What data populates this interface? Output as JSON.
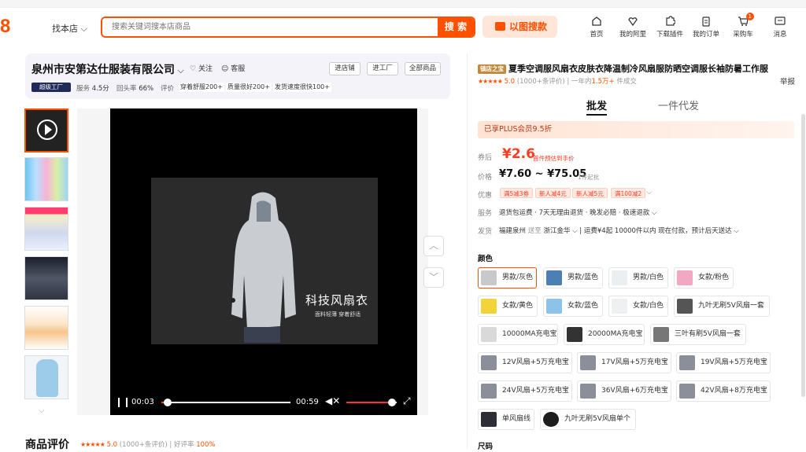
{
  "header": {
    "top_strip": "",
    "find_shop": "找本店 ⌵",
    "search_placeholder": "搜索关键词搜本店商品",
    "search_button": "搜 索",
    "image_search": "以图搜款",
    "nav": [
      {
        "label": "首页",
        "icon": "home-icon"
      },
      {
        "label": "我的阿里",
        "icon": "user-heart-icon"
      },
      {
        "label": "下载插件",
        "icon": "puzzle-icon"
      },
      {
        "label": "我的订单",
        "icon": "clipboard-icon"
      },
      {
        "label": "采购车",
        "icon": "cart-icon",
        "badge": "1"
      },
      {
        "label": "消息",
        "icon": "message-icon"
      }
    ]
  },
  "shop": {
    "name": "泉州市安第达仕服装有限公司",
    "follow": "关注",
    "service": "客服",
    "buttons": [
      "进店铺",
      "进工厂",
      "全部商品"
    ],
    "super_badge": "超级工厂",
    "service_score_label": "服务",
    "service_score": "4.5分",
    "return_rate_label": "回头率",
    "return_rate": "66%",
    "review_label": "评价",
    "tags": [
      "穿着舒服200+",
      "质量很好200+",
      "发货速度很快100+"
    ]
  },
  "video": {
    "title": "科技风扇衣",
    "subtitle": "面料轻薄 穿着舒适",
    "current_time": "00:03",
    "duration": "00:59",
    "progress": 0.05,
    "volume": 0.9
  },
  "reviews": {
    "title": "商品评价",
    "rating": "5.0",
    "count": "(1000+条评价)",
    "good_rate_label": "好评率",
    "good_rate": "100%"
  },
  "product": {
    "tag": "镇店之宝",
    "title": "夏季空调服风扇衣皮肤衣降温制冷风扇服防晒空调服长袖防暑工作服",
    "rating": "5.0",
    "rating_count": "(1000+条评价)",
    "sales_prefix": "一年内",
    "sales_value": "1.5万+",
    "sales_suffix": "件成交",
    "report": "举报",
    "tabs": [
      "批发",
      "一件代发"
    ],
    "plus_banner": "已享PLUS会员9.5折",
    "coupon_label": "券后",
    "coupon_price": "¥2.6",
    "coupon_note": "首件预估到手价",
    "price_label": "价格",
    "price_low": "¥7.60",
    "price_sep": "~",
    "price_high": "¥75.05",
    "price_note": "1件起批",
    "promo_label": "优惠",
    "promos": [
      "满5减3券",
      "新人减4元",
      "新人减5元",
      "满100减2"
    ],
    "service_label": "服务",
    "service_text": "退货包运费 · 7天无理由退货 · 晚发必赔 · 极速退款 ⌵",
    "ship_label": "发货",
    "ship_from": "福建泉州",
    "ship_to_prefix": "送至",
    "ship_to": "浙江金华 ⌵",
    "ship_fee": "运费¥4起",
    "ship_note": "10000件以内 现在付款，预计后天送达 ⌵",
    "color_title": "颜色",
    "colors": [
      "男款/灰色",
      "男款/蓝色",
      "男款/白色",
      "女款/粉色",
      "女款/黄色",
      "女款/蓝色",
      "女款/白色",
      "九叶无刷5V风扇一套",
      "10000MA充电宝",
      "20000MA充电宝",
      "三叶有刷5V风扇一套",
      "12V风扇+5万充电宝",
      "17V风扇+5万充电宝",
      "19V风扇+5万充电宝",
      "24V风扇+5万充电宝",
      "36V风扇+6万充电宝",
      "42V风扇+8万充电宝",
      "单风扇线",
      "九叶无刷5V风扇单个"
    ],
    "size_title": "尺码"
  }
}
